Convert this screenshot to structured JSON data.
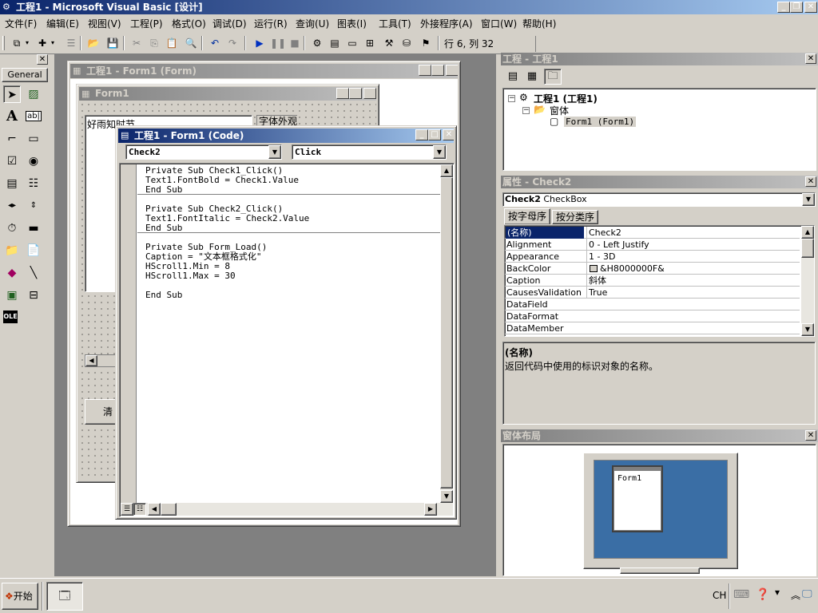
{
  "app": {
    "title": "工程1 - Microsoft Visual Basic [设计]"
  },
  "menu": [
    "文件(F)",
    "编辑(E)",
    "视图(V)",
    "工程(P)",
    "格式(O)",
    "调试(D)",
    "运行(R)",
    "查询(U)",
    "图表(I)",
    "工具(T)",
    "外接程序(A)",
    "窗口(W)",
    "帮助(H)"
  ],
  "toolbar": {
    "position": "行 6, 列 32"
  },
  "toolbox": {
    "tab_label": "General"
  },
  "form_designer": {
    "outer_title": "工程1 - Form1 (Form)",
    "inner_title": "Form1",
    "textbox_text": "好雨知时节",
    "frame_label": "字体外观",
    "button_partial": "清"
  },
  "code_window": {
    "title": "工程1 - Form1 (Code)",
    "object_dropdown": "Check2",
    "proc_dropdown": "Click",
    "blocks": [
      [
        "Private Sub Check1_Click()",
        "Text1.FontBold = Check1.Value",
        "End Sub"
      ],
      [
        "Private Sub Check2_Click()",
        "Text1.FontItalic = Check2.Value",
        "End Sub"
      ],
      [
        "Private Sub Form_Load()",
        "Caption = \"文本框格式化\"",
        "HScroll1.Min = 8",
        "HScroll1.Max = 30",
        "",
        "End Sub"
      ]
    ]
  },
  "project_pane": {
    "title": "工程 - 工程1",
    "root": "工程1 (工程1)",
    "folder": "窗体",
    "item": "Form1 (Form1)"
  },
  "properties_pane": {
    "title": "属性 - Check2",
    "object_name": "Check2",
    "object_type": "CheckBox",
    "tabs": [
      "按字母序",
      "按分类序"
    ],
    "rows": [
      {
        "name": "(名称)",
        "value": "Check2"
      },
      {
        "name": "Alignment",
        "value": "0 - Left Justify"
      },
      {
        "name": "Appearance",
        "value": "1 - 3D"
      },
      {
        "name": "BackColor",
        "value": "&H8000000F&"
      },
      {
        "name": "Caption",
        "value": "斜体"
      },
      {
        "name": "CausesValidation",
        "value": "True"
      },
      {
        "name": "DataField",
        "value": ""
      },
      {
        "name": "DataFormat",
        "value": ""
      },
      {
        "name": "DataMember",
        "value": ""
      }
    ],
    "desc_title": "(名称)",
    "desc_text": "返回代码中使用的标识对象的名称。"
  },
  "layout_pane": {
    "title": "窗体布局",
    "form_label": "Form1"
  },
  "taskbar": {
    "start": "开始",
    "lang": "CH"
  }
}
